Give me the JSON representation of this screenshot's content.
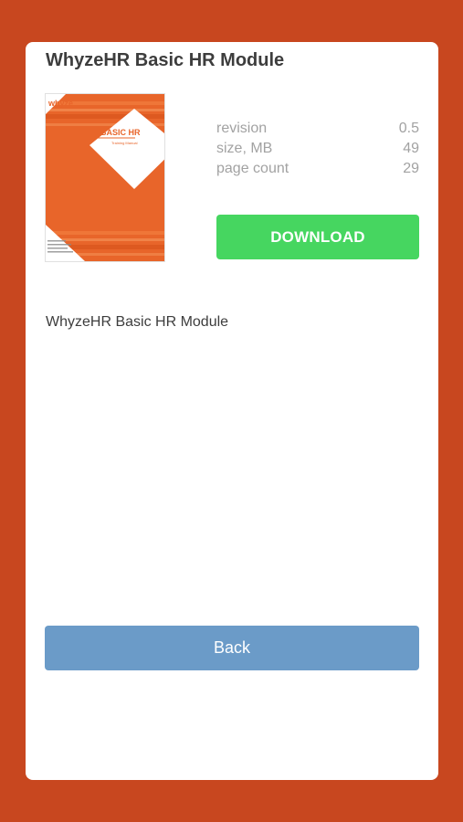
{
  "document": {
    "title": "WhyzeHR Basic HR Module",
    "description": "WhyzeHR Basic HR Module",
    "cover": {
      "logo_text": "whyze",
      "heading": "BASIC HR",
      "subheading": "Training Manual",
      "accent_color": "#e8652a"
    }
  },
  "details": [
    {
      "label": "revision",
      "value": "0.5"
    },
    {
      "label": "size, MB",
      "value": "49"
    },
    {
      "label": "page count",
      "value": "29"
    }
  ],
  "actions": {
    "download_label": "DOWNLOAD",
    "back_label": "Back"
  },
  "colors": {
    "background": "#c8471f",
    "download": "#46d660",
    "back": "#6b9bc8"
  }
}
